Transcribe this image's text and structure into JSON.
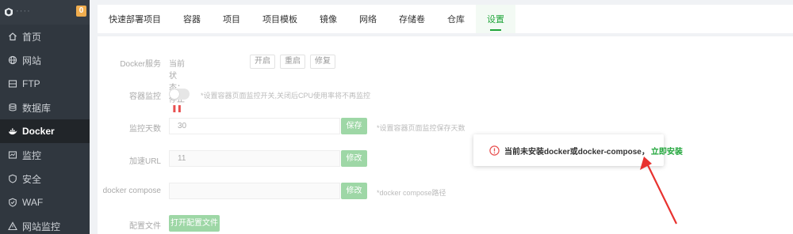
{
  "sidebar": {
    "server_name": "·  ·   ·  ·  ",
    "badge": "0",
    "items": [
      {
        "label": "首页",
        "icon": "home-icon"
      },
      {
        "label": "网站",
        "icon": "globe-icon"
      },
      {
        "label": "FTP",
        "icon": "ftp-icon"
      },
      {
        "label": "数据库",
        "icon": "database-icon"
      },
      {
        "label": "Docker",
        "icon": "docker-icon",
        "active": true
      },
      {
        "label": "监控",
        "icon": "monitor-icon"
      },
      {
        "label": "安全",
        "icon": "shield-icon"
      },
      {
        "label": "WAF",
        "icon": "waf-icon"
      },
      {
        "label": "网站监控",
        "icon": "site-monitor-icon"
      }
    ]
  },
  "tabs": [
    {
      "label": "快速部署项目"
    },
    {
      "label": "容器"
    },
    {
      "label": "项目"
    },
    {
      "label": "项目模板"
    },
    {
      "label": "镜像"
    },
    {
      "label": "网络"
    },
    {
      "label": "存储卷"
    },
    {
      "label": "仓库"
    },
    {
      "label": "设置",
      "active": true
    }
  ],
  "settings": {
    "docker_service": {
      "label": "Docker服务",
      "status": "当前状态：停止",
      "buttons": [
        "开启",
        "重启",
        "修复"
      ]
    },
    "container_monitor": {
      "label": "容器监控",
      "hint": "*设置容器页面监控开关,关闭后CPU使用率将不再监控"
    },
    "monitor_days": {
      "label": "监控天数",
      "value": "30",
      "button": "保存",
      "hint": "*设置容器页面监控保存天数"
    },
    "accel_url": {
      "label": "加速URL",
      "value": "11",
      "button": "修改"
    },
    "docker_compose": {
      "label": "docker compose",
      "value": "",
      "button": "修改",
      "hint": "*docker compose路径"
    },
    "config_file": {
      "label": "配置文件",
      "button": "打开配置文件"
    }
  },
  "toast": {
    "message": "当前未安装docker或docker-compose，",
    "link": "立即安装",
    "icon": "warning-circle-icon"
  },
  "colors": {
    "accent": "#20a53a",
    "sidebar_bg": "#30373f",
    "warning": "#e84f4f",
    "arrow": "#e8322f"
  }
}
